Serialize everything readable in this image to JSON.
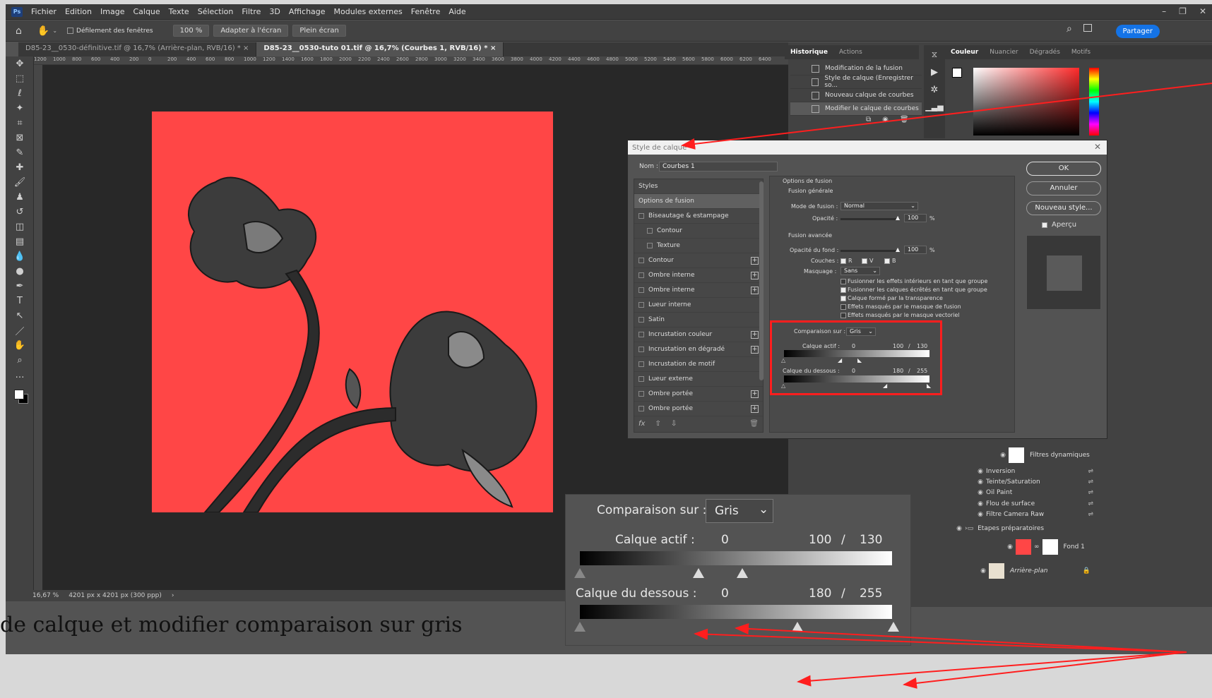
{
  "menubar": {
    "logo": "Ps",
    "items": [
      "Fichier",
      "Edition",
      "Image",
      "Calque",
      "Texte",
      "Sélection",
      "Filtre",
      "3D",
      "Affichage",
      "Modules externes",
      "Fenêtre",
      "Aide"
    ]
  },
  "options": {
    "scroll_all": "Défilement des fenêtres",
    "zoom": "100 %",
    "fit": "Adapter à l'écran",
    "fullscreen": "Plein écran",
    "share": "Partager"
  },
  "tabs": [
    {
      "label": "D85-23__0530-définitive.tif @ 16,7% (Arrière-plan, RVB/16) *"
    },
    {
      "label": "D85-23__0530-tuto 01.tif @ 16,7% (Courbes 1, RVB/16) *"
    }
  ],
  "ruler_ticks": [
    "1200",
    "1000",
    "800",
    "600",
    "400",
    "200",
    "0",
    "200",
    "400",
    "600",
    "800",
    "1000",
    "1200",
    "1400",
    "1600",
    "1800",
    "2000",
    "2200",
    "2400",
    "2600",
    "2800",
    "3000",
    "3200",
    "3400",
    "3600",
    "3800",
    "4000",
    "4200",
    "4400",
    "4600",
    "4800",
    "5000",
    "5200",
    "5400",
    "5600",
    "5800",
    "6000",
    "6200",
    "6400"
  ],
  "status": {
    "zoom": "16,67 %",
    "size": "4201 px x 4201 px (300 ppp)"
  },
  "history": {
    "tabs": [
      "Historique",
      "Actions"
    ],
    "items": [
      "Modification de la fusion",
      "Style de calque (Enregistrer so...",
      "Nouveau calque de courbes",
      "Modifier le calque de courbes"
    ]
  },
  "color_panel": {
    "tabs": [
      "Couleur",
      "Nuancier",
      "Dégradés",
      "Motifs"
    ]
  },
  "layers": {
    "items": [
      "Filtres dynamiques",
      "Inversion",
      "Teinte/Saturation",
      "Oil Paint",
      "Flou de surface",
      "Filtre Camera Raw",
      "Etapes préparatoires",
      "Fond 1",
      "Arrière-plan"
    ]
  },
  "dialog": {
    "title": "Style de calque",
    "name_label": "Nom :",
    "name_value": "Courbes 1",
    "styles_header": "Styles",
    "styles": [
      {
        "label": "Options de fusion",
        "sel": true,
        "cb": false,
        "plus": false,
        "indent": false
      },
      {
        "label": "Biseautage & estampage",
        "cb": true,
        "plus": false,
        "indent": false
      },
      {
        "label": "Contour",
        "cb": true,
        "plus": false,
        "indent": true
      },
      {
        "label": "Texture",
        "cb": true,
        "plus": false,
        "indent": true
      },
      {
        "label": "Contour",
        "cb": true,
        "plus": true,
        "indent": false
      },
      {
        "label": "Ombre interne",
        "cb": true,
        "plus": true,
        "indent": false
      },
      {
        "label": "Ombre interne",
        "cb": true,
        "plus": true,
        "indent": false
      },
      {
        "label": "Lueur interne",
        "cb": true,
        "plus": false,
        "indent": false
      },
      {
        "label": "Satin",
        "cb": true,
        "plus": false,
        "indent": false
      },
      {
        "label": "Incrustation couleur",
        "cb": true,
        "plus": true,
        "indent": false
      },
      {
        "label": "Incrustation en dégradé",
        "cb": true,
        "plus": true,
        "indent": false
      },
      {
        "label": "Incrustation de motif",
        "cb": true,
        "plus": false,
        "indent": false
      },
      {
        "label": "Lueur externe",
        "cb": true,
        "plus": false,
        "indent": false
      },
      {
        "label": "Ombre portée",
        "cb": true,
        "plus": true,
        "indent": false
      },
      {
        "label": "Ombre portée",
        "cb": true,
        "plus": true,
        "indent": false
      }
    ],
    "opts_title": "Options de fusion",
    "general": "Fusion générale",
    "mode_label": "Mode de fusion :",
    "mode_value": "Normal",
    "opacity_label": "Opacité :",
    "opacity_value": "100",
    "pct": "%",
    "advanced": "Fusion avancée",
    "fill_label": "Opacité du fond :",
    "fill_value": "100",
    "channels_label": "Couches :",
    "ch_r": "R",
    "ch_v": "V",
    "ch_b": "B",
    "knockout_label": "Masquage :",
    "knockout_value": "Sans",
    "checks": [
      "Fusionner les effets intérieurs en tant que groupe",
      "Fusionner les calques écrêtés en tant que groupe",
      "Calque formé par la transparence",
      "Effets masqués par le masque de fusion",
      "Effets masqués par le masque vectoriel"
    ],
    "compare_label": "Comparaison sur :",
    "compare_value": "Gris",
    "this_layer": "Calque actif :",
    "this_lo": "0",
    "this_hi1": "100",
    "slash": "/",
    "this_hi2": "130",
    "under_layer": "Calque du dessous :",
    "under_lo": "0",
    "under_hi1": "180",
    "under_hi2": "255",
    "buttons": {
      "ok": "OK",
      "cancel": "Annuler",
      "new_style": "Nouveau style...",
      "preview": "Aperçu"
    }
  },
  "caption": "de calque et modifier comparaison sur gris"
}
